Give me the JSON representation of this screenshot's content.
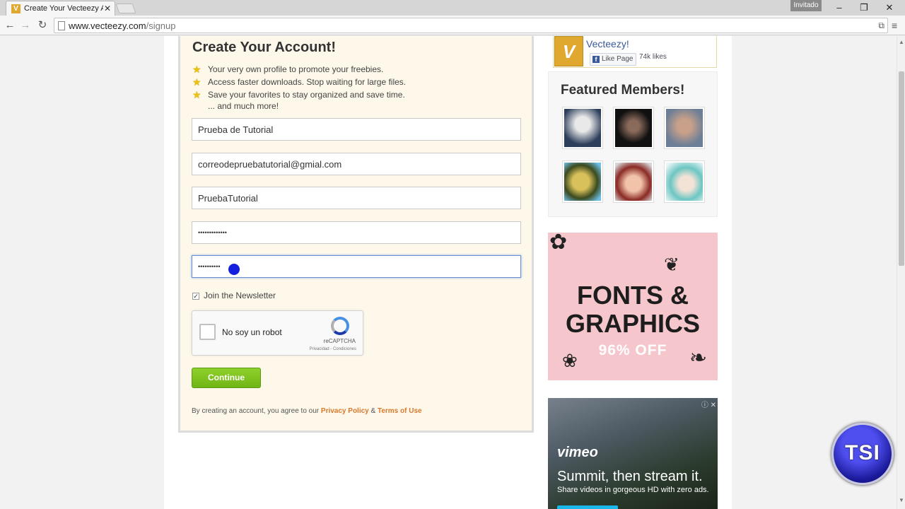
{
  "browser": {
    "tab_title": "Create Your Vecteezy Acco",
    "favicon": "V",
    "profile_label": "Invitado",
    "url_host": "www.vecteezy.com",
    "url_path": "/signup",
    "window_controls": [
      "minimize-icon",
      "restore-icon",
      "close-icon"
    ]
  },
  "signup": {
    "title": "Create Your Account!",
    "benefits": [
      "Your very own profile to promote your freebies.",
      "Access faster downloads. Stop waiting for large files.",
      "Save your favorites to stay organized and save time."
    ],
    "more_text": "... and much more!",
    "fields": {
      "name_value": "Prueba de Tutorial",
      "email_value": "correodepruebatutorial@gmial.com",
      "username_value": "PruebaTutorial",
      "password_mask": "•••••••••••••",
      "confirm_mask": "••••••••••"
    },
    "newsletter_label": "Join the Newsletter",
    "newsletter_checked": true,
    "captcha": {
      "label": "No soy un robot",
      "brand": "reCAPTCHA",
      "terms": "Privacidad - Condiciones"
    },
    "continue_label": "Continue",
    "legal_prefix": "By creating an account, you agree to our",
    "privacy_link": "Privacy Policy",
    "amp": "&",
    "terms_link": "Terms of Use"
  },
  "sidebar": {
    "fb": {
      "logo": "V",
      "page_name": "Vecteezy!",
      "like_label": "Like Page",
      "likes": "74k likes"
    },
    "featured_title": "Featured Members!",
    "ad_fonts": {
      "line1": "FONTS &",
      "line2": "GRAPHICS",
      "line3": "96% OFF"
    },
    "ad_vimeo": {
      "logo": "vimeo",
      "headline": "Summit, then stream it.",
      "subline": "Share videos in gorgeous HD with zero ads."
    }
  },
  "watermark": "TSI",
  "colors": {
    "card_bg": "#fdf8ea",
    "continue_green": "#7dc21e",
    "link_orange": "#d9782b",
    "star_yellow": "#e9c10e",
    "brand_gold": "#e0a82e"
  }
}
